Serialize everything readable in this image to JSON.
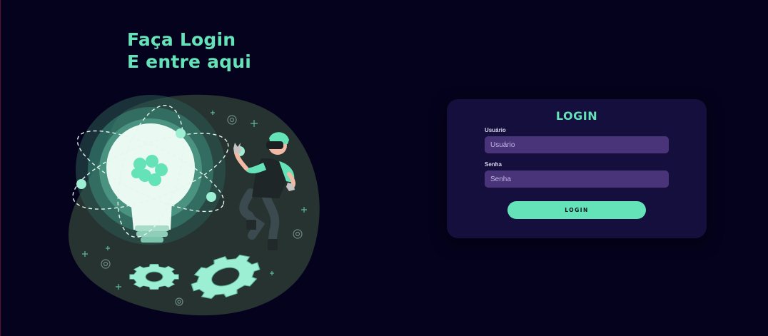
{
  "hero": {
    "line1": "Faça Login",
    "line2": "E entre aqui"
  },
  "illustration": {
    "description_icons": [
      "lightbulb-icon",
      "atom-orbit-icon",
      "gear-icon",
      "vr-person-icon",
      "sparkle-icon"
    ]
  },
  "login_card": {
    "title": "LOGIN",
    "username": {
      "label": "Usuário",
      "placeholder": "Usuário",
      "value": ""
    },
    "password": {
      "label": "Senha",
      "placeholder": "Senha",
      "value": ""
    },
    "submit_label": "LOGIN"
  },
  "colors": {
    "background": "#05021d",
    "accent": "#64e3b8",
    "card": "#150f3e",
    "input": "#4a3479"
  }
}
